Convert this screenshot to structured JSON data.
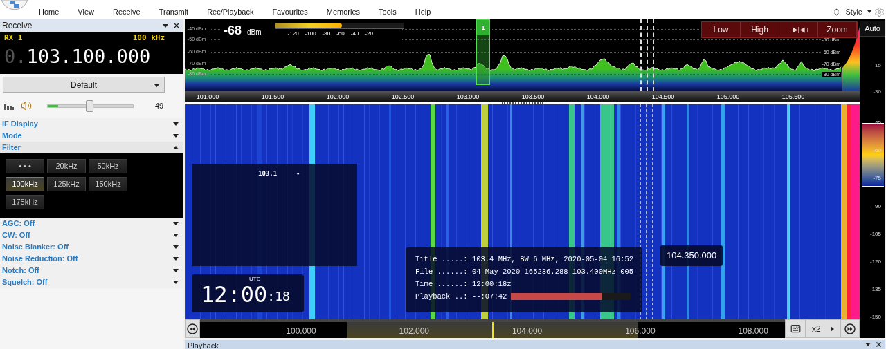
{
  "menu": [
    "Home",
    "View",
    "Receive",
    "Transmit",
    "Rec/Playback",
    "Favourites",
    "Memories",
    "Tools",
    "Help"
  ],
  "style_menu": "Style",
  "receive_panel": {
    "title": "Receive",
    "rx_label": "RX 1",
    "step": "100 kHz",
    "frequency_prefix": "0.",
    "frequency": "103.100.000",
    "preset": "Default",
    "volume": {
      "level": 0.49,
      "reading": "49"
    },
    "sections_top": [
      {
        "label": "IF Display",
        "expanded": false
      },
      {
        "label": "Mode",
        "expanded": false
      },
      {
        "label": "Filter",
        "expanded": true
      }
    ],
    "filters": [
      {
        "label": "• • •",
        "selected": false
      },
      {
        "label": "20kHz",
        "selected": false
      },
      {
        "label": "50kHz",
        "selected": false
      },
      {
        "label": "100kHz",
        "selected": true
      },
      {
        "label": "125kHz",
        "selected": false
      },
      {
        "label": "150kHz",
        "selected": false
      },
      {
        "label": "175kHz",
        "selected": false
      }
    ],
    "sections_bottom": [
      {
        "label": "AGC: Off",
        "expanded": false
      },
      {
        "label": "CW: Off",
        "expanded": false
      },
      {
        "label": "Noise Blanker: Off",
        "expanded": false
      },
      {
        "label": "Noise Reduction: Off",
        "expanded": false
      },
      {
        "label": "Notch: Off",
        "expanded": false
      },
      {
        "label": "Squelch: Off",
        "expanded": false
      }
    ]
  },
  "spectrum": {
    "signal": {
      "reading": "-68",
      "unit": "dBm",
      "level": 0.52,
      "scale": [
        "-120",
        "-100",
        "-80",
        "-60",
        "-40",
        "-20"
      ]
    },
    "db_labels_left": [
      "-40 dBm",
      "-50 dBm",
      "-60 dBm",
      "-70 dBm",
      "-80 dBm"
    ],
    "db_labels_right": [
      "-50 dBm",
      "-60 dBm",
      "-70 dBm",
      "-80 dBm"
    ],
    "marker": "1",
    "buttons": [
      {
        "kind": "text",
        "label": "Low"
      },
      {
        "kind": "text",
        "label": "High"
      },
      {
        "kind": "icon"
      },
      {
        "kind": "text",
        "label": "Zoom"
      }
    ],
    "freq_labels": [
      "101.000",
      "101.500",
      "102.000",
      "102.500",
      "103.000",
      "103.500",
      "104.000",
      "104.500",
      "105.000",
      "105.500"
    ]
  },
  "waterfall": {
    "channel_label": {
      "frequency": "103.1",
      "name": "-"
    },
    "clock": {
      "zone": "UTC",
      "time": "12:00",
      "seconds": ":18"
    },
    "info": {
      "lines": [
        "Title .....: 103.4 MHz, BW 6 MHz, 2020-05-04 16:52",
        "File ......: 04-May-2020 165236.288 103.400MHz 005",
        "Time ......: 12:00:18z"
      ],
      "playback": {
        "label": "Playback ..: --:07:42",
        "level": 0.76
      }
    },
    "cursor_frequency": "104.350.000"
  },
  "timeline": {
    "labels": [
      "100.000",
      "102.000",
      "104.000",
      "106.000",
      "108.000"
    ],
    "speed": "x2"
  },
  "level_scale": {
    "auto": "Auto",
    "labels": [
      "-15",
      "-30"
    ],
    "waterfall_labels": [
      "-45",
      "-60",
      "-75",
      "-90",
      "-105",
      "-120",
      "-135",
      "-150"
    ]
  },
  "playback_panel": {
    "title": "Playback"
  }
}
